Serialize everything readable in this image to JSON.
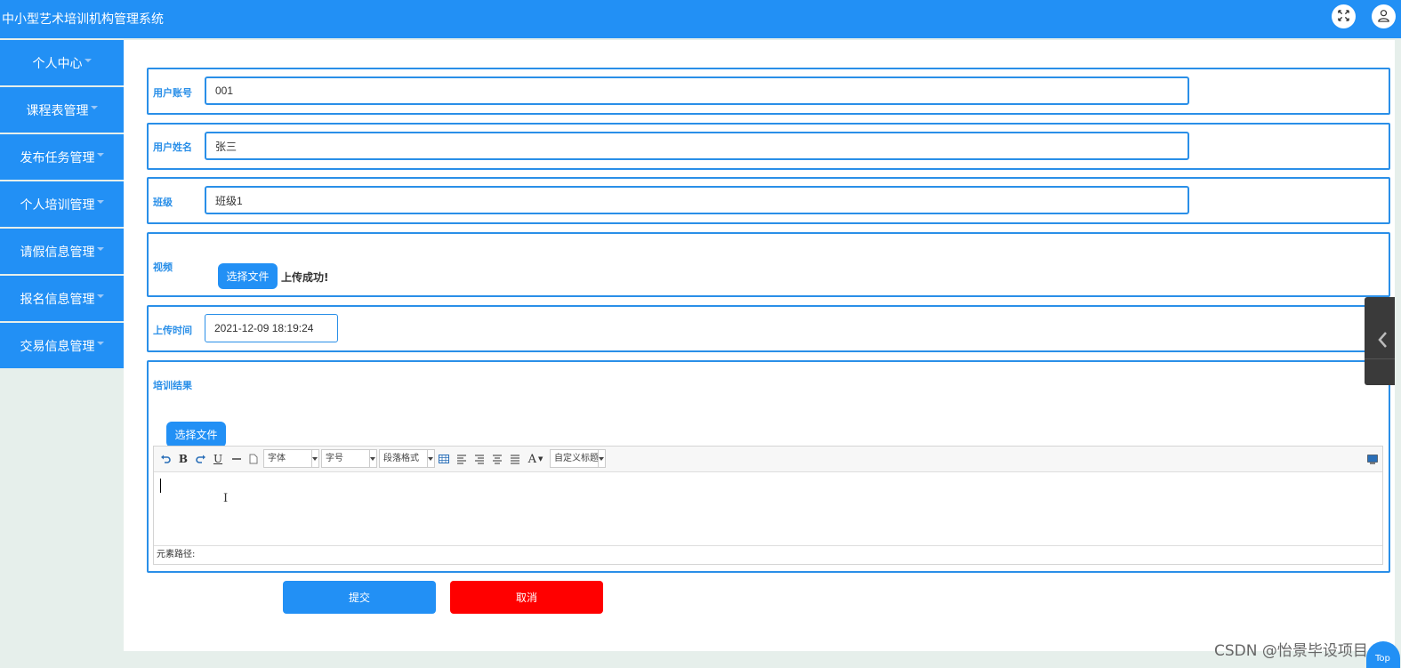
{
  "app": {
    "title": "中小型艺术培训机构管理系统"
  },
  "header": {
    "fullscreen_icon": "expand-icon",
    "user_icon": "user-icon"
  },
  "sidebar": {
    "items": [
      {
        "label": "个人中心"
      },
      {
        "label": "课程表管理"
      },
      {
        "label": "发布任务管理"
      },
      {
        "label": "个人培训管理"
      },
      {
        "label": "请假信息管理"
      },
      {
        "label": "报名信息管理"
      },
      {
        "label": "交易信息管理"
      }
    ]
  },
  "form": {
    "account": {
      "label": "用户账号",
      "value": "001"
    },
    "name": {
      "label": "用户姓名",
      "value": "张三"
    },
    "class": {
      "label": "班级",
      "value": "班级1"
    },
    "video": {
      "label": "视频",
      "button": "选择文件",
      "status": "上传成功!"
    },
    "upload_time": {
      "label": "上传时间",
      "value": "2021-12-09 18:19:24"
    },
    "result": {
      "label": "培训结果",
      "button": "选择文件",
      "toolbar": {
        "bold": "B",
        "underline": "U",
        "font_family": "字体",
        "font_size": "字号",
        "paragraph": "段落格式",
        "font_color": "A",
        "custom_title": "自定义标题"
      },
      "element_path": "元素路径:"
    },
    "submit": "提交",
    "cancel": "取消"
  },
  "colors": {
    "primary": "#2290f5",
    "danger": "#ff0000",
    "border": "#2a8fe8"
  },
  "watermark": "CSDN @怡景毕设项目",
  "back_to_top": "Top"
}
